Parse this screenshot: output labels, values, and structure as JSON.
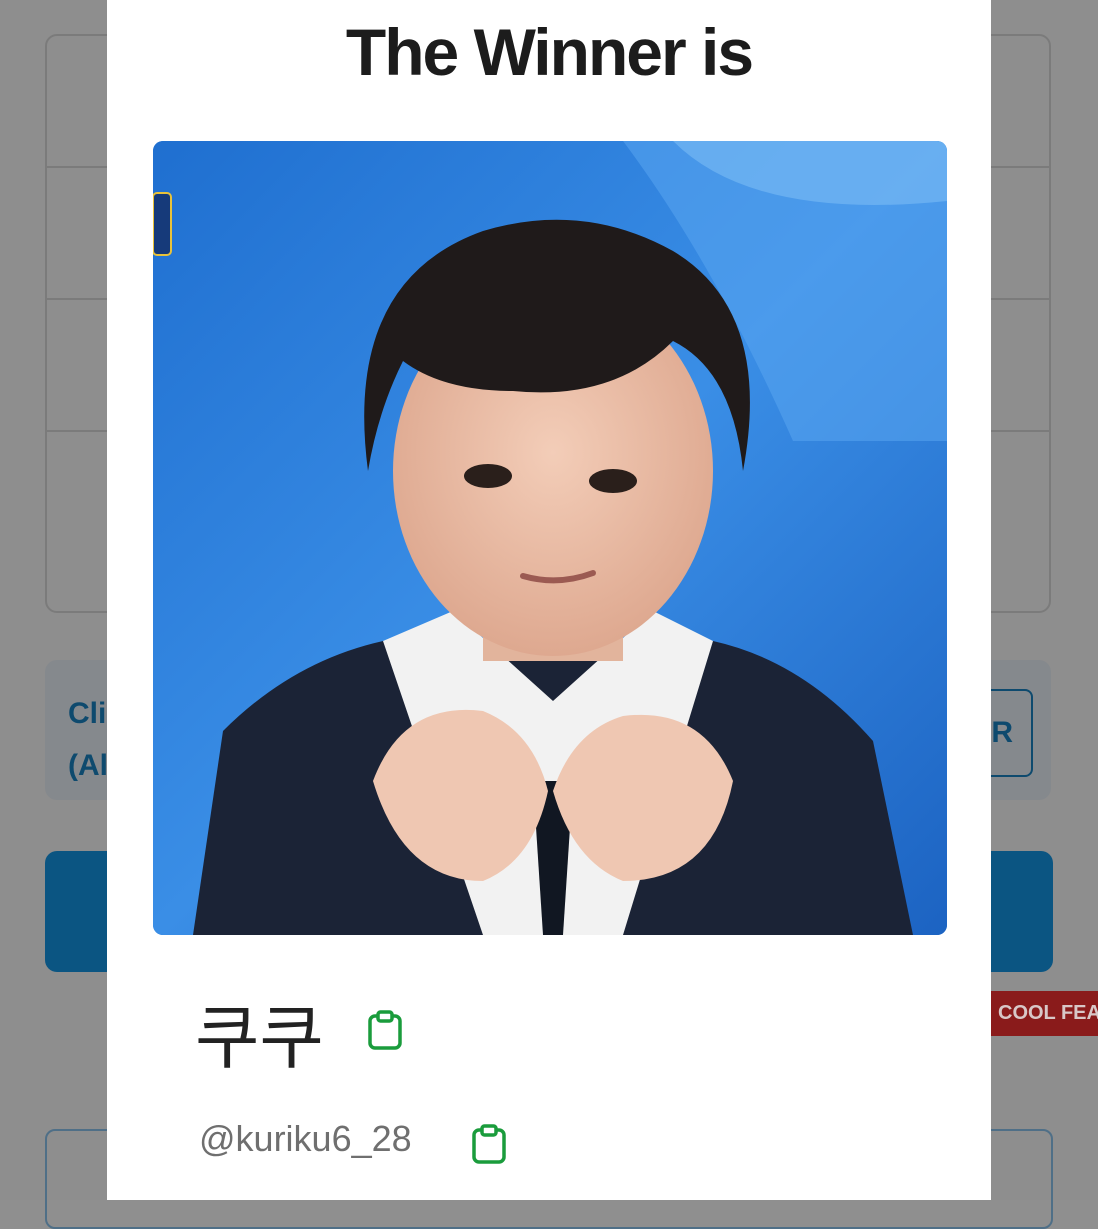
{
  "background": {
    "info_text": "Cli\n(Al",
    "outline_button_label": "R",
    "ribbon_label": "COOL FEAT"
  },
  "modal": {
    "title": "The Winner is",
    "winner": {
      "name": "쿠쿠",
      "handle": "@kuriku6_28"
    },
    "icons": {
      "copy_name": "clipboard-icon",
      "copy_handle": "clipboard-icon"
    }
  },
  "colors": {
    "overlay_gray": "#8e8e8e",
    "accent_blue": "#0b5582",
    "clipboard_green": "#1a9c3c",
    "ribbon_red": "#8a1b1b"
  }
}
